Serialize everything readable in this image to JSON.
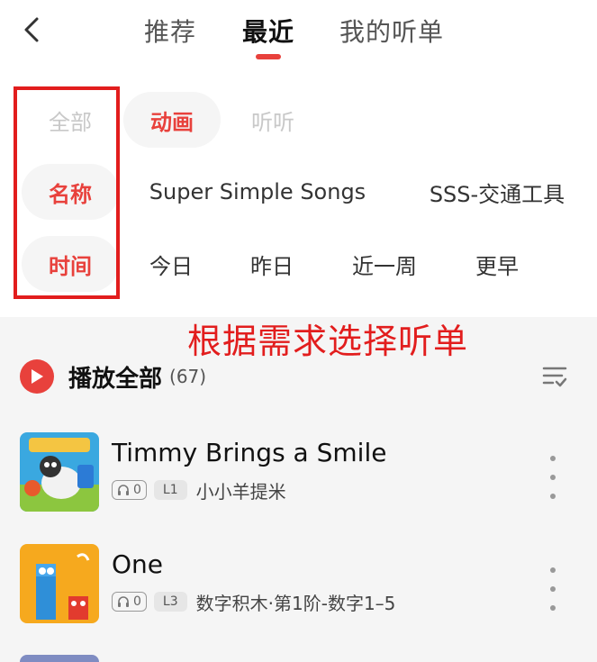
{
  "header": {
    "tabs": [
      {
        "label": "推荐",
        "active": false
      },
      {
        "label": "最近",
        "active": true
      },
      {
        "label": "我的听单",
        "active": false
      }
    ]
  },
  "filters": {
    "type_row": {
      "label": "全部",
      "options": [
        "动画",
        "听听"
      ],
      "selected": "动画"
    },
    "name_row": {
      "label": "名称",
      "options": [
        "Super Simple Songs",
        "SSS-交通工具"
      ]
    },
    "time_row": {
      "label": "时间",
      "options": [
        "今日",
        "昨日",
        "近一周",
        "更早"
      ]
    }
  },
  "annotation": "根据需求选择听单",
  "play_all": {
    "label": "播放全部",
    "count": "(67)"
  },
  "items": [
    {
      "title": "Timmy Brings a Smile",
      "listens": "0",
      "level": "L1",
      "series": "小小羊提米",
      "thumb": "timmy-thumbnail"
    },
    {
      "title": "One",
      "listens": "0",
      "level": "L3",
      "series": "数字积木·第1阶-数字1–5",
      "thumb": "numberblocks-thumbnail"
    }
  ],
  "colors": {
    "accent": "#e8413c",
    "annotation": "#e21d1d",
    "list_bg": "#f5f5f5"
  }
}
